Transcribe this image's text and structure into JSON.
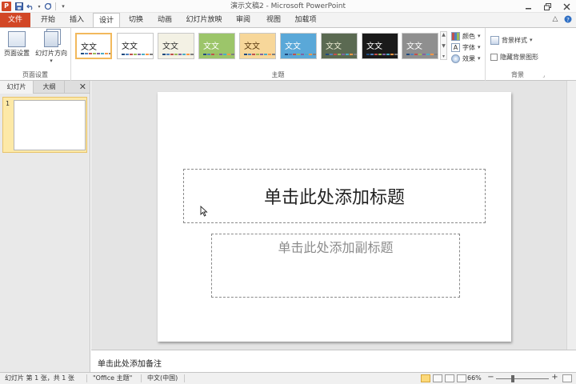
{
  "window": {
    "title": "演示文稿2 - Microsoft PowerPoint",
    "app_icon": "P"
  },
  "qat": {
    "save_icon": "save-icon",
    "undo_icon": "undo-icon",
    "redo_icon": "redo-icon",
    "customize_icon": "customize-qat-icon"
  },
  "tabs": [
    {
      "label": "文件"
    },
    {
      "label": "开始"
    },
    {
      "label": "插入"
    },
    {
      "label": "设计"
    },
    {
      "label": "切换"
    },
    {
      "label": "动画"
    },
    {
      "label": "幻灯片放映"
    },
    {
      "label": "审阅"
    },
    {
      "label": "视图"
    },
    {
      "label": "加载项"
    }
  ],
  "ribbon": {
    "page_setup_group": {
      "label": "页面设置",
      "page_setup_btn": "页面设置",
      "orientation_btn": "幻灯片方向"
    },
    "themes_group": {
      "label": "主题",
      "themes": [
        {
          "text": "文文",
          "bg": "#ffffff",
          "fg": "#222222"
        },
        {
          "text": "文文",
          "bg": "#ffffff",
          "fg": "#222222"
        },
        {
          "text": "文文",
          "bg": "#f3f1e4",
          "fg": "#333333"
        },
        {
          "text": "文文",
          "bg": "#9cc56a",
          "fg": "#ffffff"
        },
        {
          "text": "文文",
          "bg": "#f7d79a",
          "fg": "#5a3a10"
        },
        {
          "text": "文文",
          "bg": "#5aa8d8",
          "fg": "#ffffff"
        },
        {
          "text": "文文",
          "bg": "#5b6a52",
          "fg": "#e8e8d0"
        },
        {
          "text": "文文",
          "bg": "#1a1a1a",
          "fg": "#ffffff"
        },
        {
          "text": "文文",
          "bg": "#8f8f8f",
          "fg": "#ffffff"
        }
      ],
      "colors_btn": "颜色",
      "fonts_btn": "字体",
      "effects_btn": "效果"
    },
    "background_group": {
      "label": "背景",
      "bg_styles_btn": "背景样式",
      "hide_bg_graphics": "隐藏背景图形"
    }
  },
  "panes": {
    "slides_tab": "幻灯片",
    "outline_tab": "大纲",
    "close_icon": "close-icon",
    "slide_number": "1"
  },
  "slide": {
    "title_placeholder": "单击此处添加标题",
    "subtitle_placeholder": "单击此处添加副标题"
  },
  "notes": {
    "placeholder": "单击此处添加备注"
  },
  "status": {
    "slide_info": "幻灯片 第 1 张，共 1 张",
    "theme": "\"Office 主题\"",
    "language": "中文(中国)",
    "zoom": "66%"
  },
  "colors": {
    "file_tab": "#d24726",
    "selected_thumb": "#fde9a7",
    "selected_theme_border": "#f2b95c"
  }
}
